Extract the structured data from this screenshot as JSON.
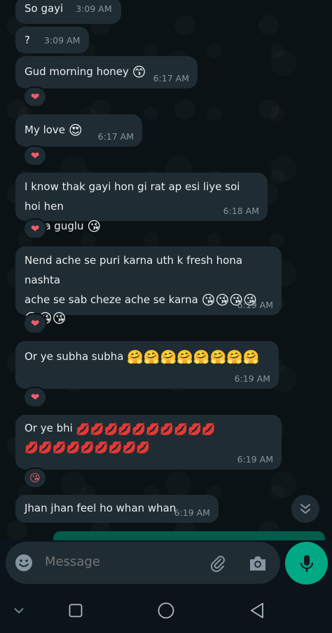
{
  "colors": {
    "chat_bg": "#0b1216",
    "bubble_bg": "#1f2c33",
    "time_text": "#8696a0",
    "accent": "#00a884",
    "heart": "#f15c6d"
  },
  "messages": [
    {
      "text": "So gayi",
      "time": "3:09 AM"
    },
    {
      "text": "?",
      "time": "3:09 AM"
    },
    {
      "text": "Gud morning honey",
      "emoji": "😙",
      "time": "6:17 AM",
      "reaction": "❤"
    },
    {
      "text": "My love",
      "emoji": "😍",
      "time": "6:17 AM",
      "reaction": "❤"
    },
    {
      "line1": "I know thak gayi hon gi rat ap esi liye soi hoi hen",
      "line2": "Mera guglu",
      "emoji": "😘",
      "time": "6:18 AM",
      "reaction": "❤"
    },
    {
      "line1": "Nend ache se puri karna uth k fresh hona nashta",
      "line2": "ache se sab cheze ache se karna",
      "emoji_line2": "😘😘😘😘",
      "emoji_line3": "😘😘😘",
      "time": "6:19 AM",
      "reaction": "❤"
    },
    {
      "text": "Or ye subha subha",
      "emoji": "🤗🤗🤗🤗🤗🤗🤗🤗",
      "time": "6:19 AM",
      "reaction": "❤"
    },
    {
      "text": "Or ye bhi",
      "emoji": "💋💋💋💋💋💋💋💋💋💋",
      "emoji_line2": "💋💋💋💋💋💋💋💋💋",
      "time": "6:19 AM",
      "reaction": "😘"
    },
    {
      "text": "Jhan jhan feel ho whan whan",
      "time": "6:19 AM"
    }
  ],
  "composer": {
    "placeholder": "Message",
    "emoji_icon": "smiley-icon",
    "attach_icon": "paperclip-icon",
    "camera_icon": "camera-icon",
    "mic_icon": "microphone-icon"
  },
  "scroll_button_icon": "double-chevron-down-icon",
  "navbar": {
    "icons": [
      "chevron-down-icon",
      "square-icon",
      "circle-icon",
      "triangle-back-icon"
    ]
  }
}
